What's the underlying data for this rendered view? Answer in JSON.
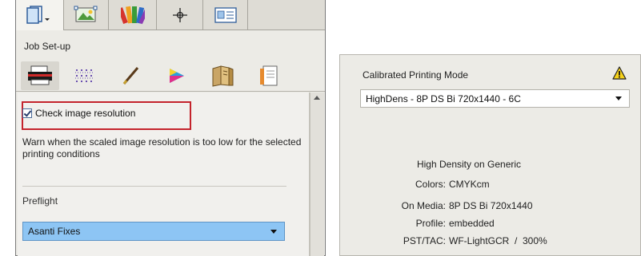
{
  "left_panel": {
    "top_tabs": [
      {
        "icon": "page-menu-icon",
        "active": true
      },
      {
        "icon": "image-icon",
        "active": false
      },
      {
        "icon": "color-swatches-icon",
        "active": false
      },
      {
        "icon": "crosshair-icon",
        "active": false
      },
      {
        "icon": "layout-icon",
        "active": false
      }
    ],
    "section_title": "Job Set-up",
    "sub_tabs": [
      {
        "icon": "printer-icon",
        "active": true
      },
      {
        "icon": "grid-icon",
        "active": false
      },
      {
        "icon": "pen-icon",
        "active": false
      },
      {
        "icon": "color-wheel-icon",
        "active": false
      },
      {
        "icon": "book-icon",
        "active": false
      },
      {
        "icon": "document-icon",
        "active": false
      }
    ],
    "check_image_resolution": {
      "label": "Check image resolution",
      "checked": true,
      "highlight_color": "#c4232c"
    },
    "warning_text": "Warn when the scaled image resolution is too low for the selected printing conditions",
    "preflight": {
      "label": "Preflight",
      "selected": "Asanti Fixes"
    }
  },
  "right_panel": {
    "calibrated_label": "Calibrated Printing Mode",
    "mode_selected": "HighDens - 8P DS Bi 720x1440 - 6C",
    "info_title": "High Density on Generic",
    "info": [
      {
        "key": "Colors:",
        "value": "CMYKcm"
      },
      {
        "key": "On Media:",
        "value": "8P DS Bi 720x1440"
      },
      {
        "key": "Profile:",
        "value": "embedded"
      },
      {
        "key": "PST/TAC:",
        "value": "WF-LightGCR  /  300%"
      }
    ]
  }
}
